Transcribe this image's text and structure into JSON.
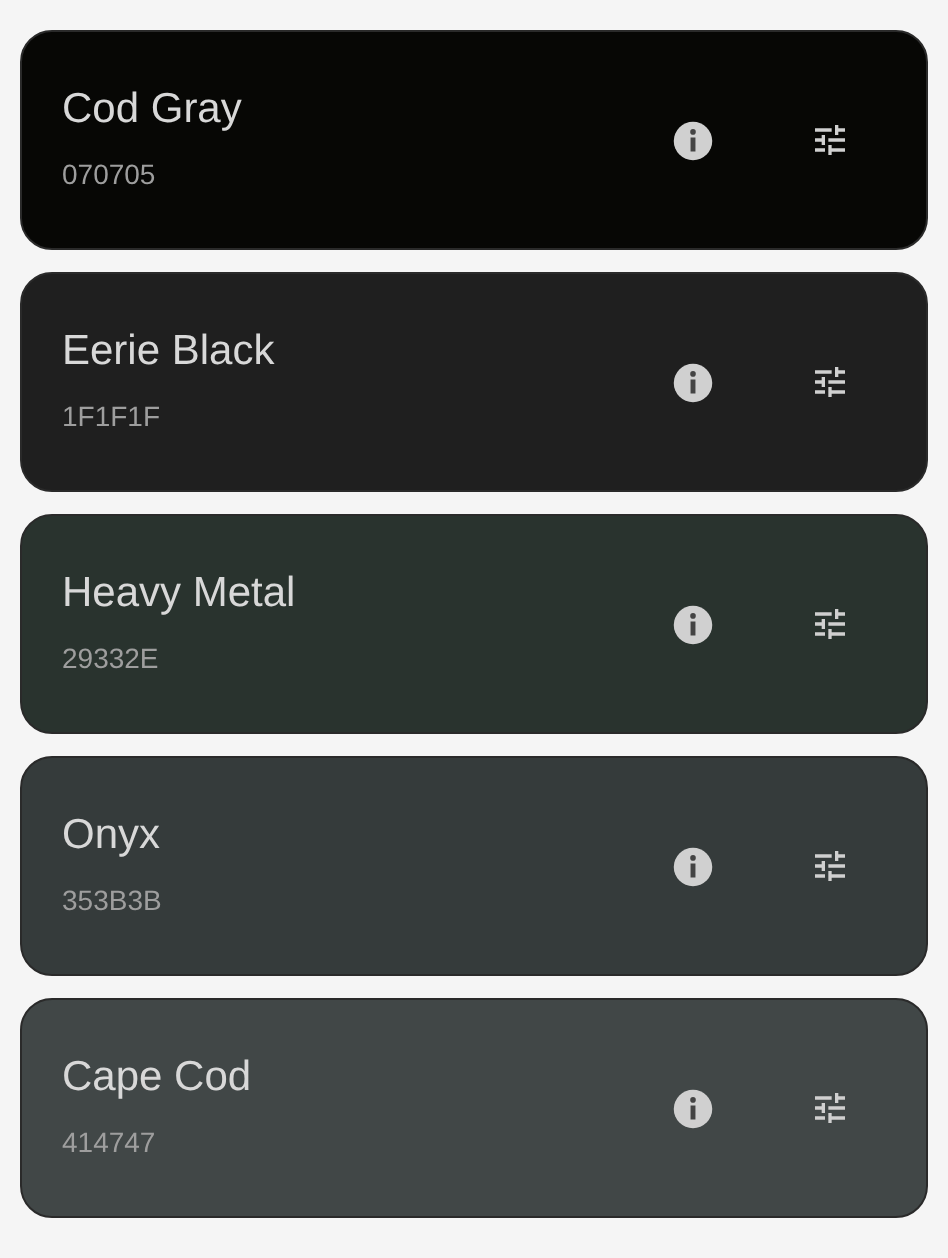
{
  "colors": [
    {
      "name": "Cod Gray",
      "hex": "070705",
      "color": "#070705"
    },
    {
      "name": "Eerie Black",
      "hex": "1F1F1F",
      "color": "#1f1f1f"
    },
    {
      "name": "Heavy Metal",
      "hex": "29332E",
      "color": "#29332e"
    },
    {
      "name": "Onyx",
      "hex": "353B3B",
      "color": "#353b3b"
    },
    {
      "name": "Cape Cod",
      "hex": "414747",
      "color": "#414747"
    }
  ]
}
